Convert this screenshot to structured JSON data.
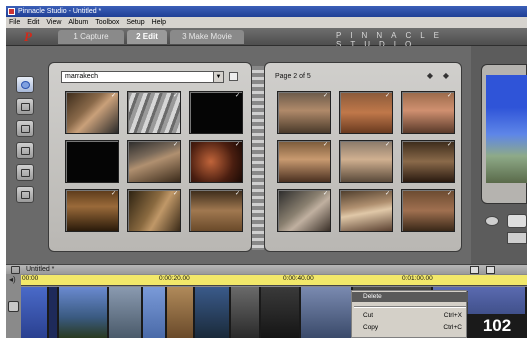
{
  "window": {
    "title": "Pinnacle Studio - Untitled *"
  },
  "menu": [
    "File",
    "Edit",
    "View",
    "Album",
    "Toolbox",
    "Setup",
    "Help"
  ],
  "mode_tabs": {
    "capture": "1 Capture",
    "edit": "2 Edit",
    "make_movie": "3 Make Movie"
  },
  "brand": "PINNACLE STUDIO",
  "album": {
    "dropdown_value": "marrakech",
    "page_label": "Page 2 of 5"
  },
  "timeline": {
    "title": "Untitled *",
    "ruler_ticks": [
      "00:00",
      "0:00:20.00",
      "0:00:40.00",
      "0:01:00.00"
    ]
  },
  "context_menu": {
    "items": [
      {
        "label": "Delete",
        "shortcut": ""
      },
      {
        "label": "Cut",
        "shortcut": "Ctrl+X"
      },
      {
        "label": "Copy",
        "shortcut": "Ctrl+C"
      }
    ]
  },
  "page_number": "102",
  "icons": {
    "album_tools": [
      "video-scenes-icon",
      "transitions-icon",
      "titles-icon",
      "still-images-icon",
      "sound-effects-icon",
      "music-icon"
    ],
    "nav_prev": "◆",
    "nav_next": "◆",
    "checkmark": "✓"
  },
  "colors": {
    "accent_red": "#d12a1a",
    "ruler_yellow": "#f2e86a",
    "titlebar_blue": "#2c4ea8"
  }
}
